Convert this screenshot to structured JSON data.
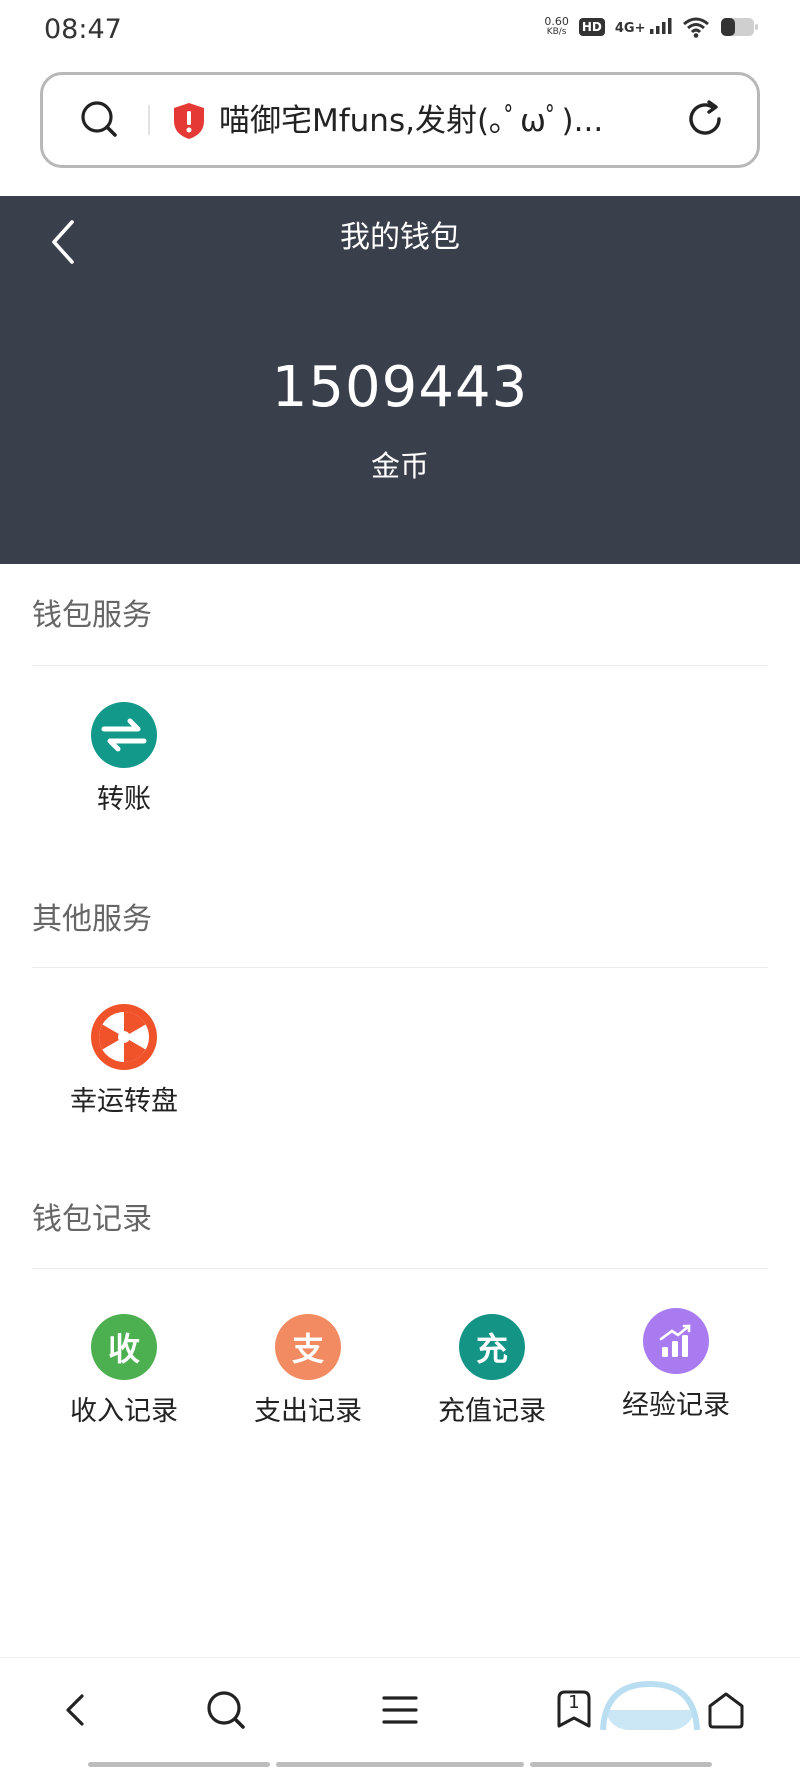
{
  "status_bar": {
    "time": "08:47",
    "net_speed_value": "0.60",
    "net_speed_unit": "KB/s",
    "hd": "HD",
    "network": "4G+"
  },
  "url_bar": {
    "title": "喵御宅Mfuns,发射(｡ﾟωﾟ)..."
  },
  "wallet": {
    "title": "我的钱包",
    "balance": "1509443",
    "currency": "金币"
  },
  "sections": {
    "wallet_services": {
      "title": "钱包服务",
      "items": [
        {
          "label": "转账",
          "icon": "transfer-icon",
          "color": "#12998a"
        }
      ]
    },
    "other_services": {
      "title": "其他服务",
      "items": [
        {
          "label": "幸运转盘",
          "icon": "lucky-wheel-icon",
          "color": "#f0522a"
        }
      ]
    },
    "wallet_records": {
      "title": "钱包记录",
      "items": [
        {
          "label": "收入记录",
          "glyph": "收",
          "icon": "income-icon",
          "color": "#4caf50"
        },
        {
          "label": "支出记录",
          "glyph": "支",
          "icon": "expense-icon",
          "color": "#f28a62"
        },
        {
          "label": "充值记录",
          "glyph": "充",
          "icon": "recharge-icon",
          "color": "#139485"
        },
        {
          "label": "经验记录",
          "icon": "experience-chart-icon",
          "color": "#a97bf0"
        }
      ]
    }
  },
  "bottom_nav": {
    "tab_count": "1"
  }
}
